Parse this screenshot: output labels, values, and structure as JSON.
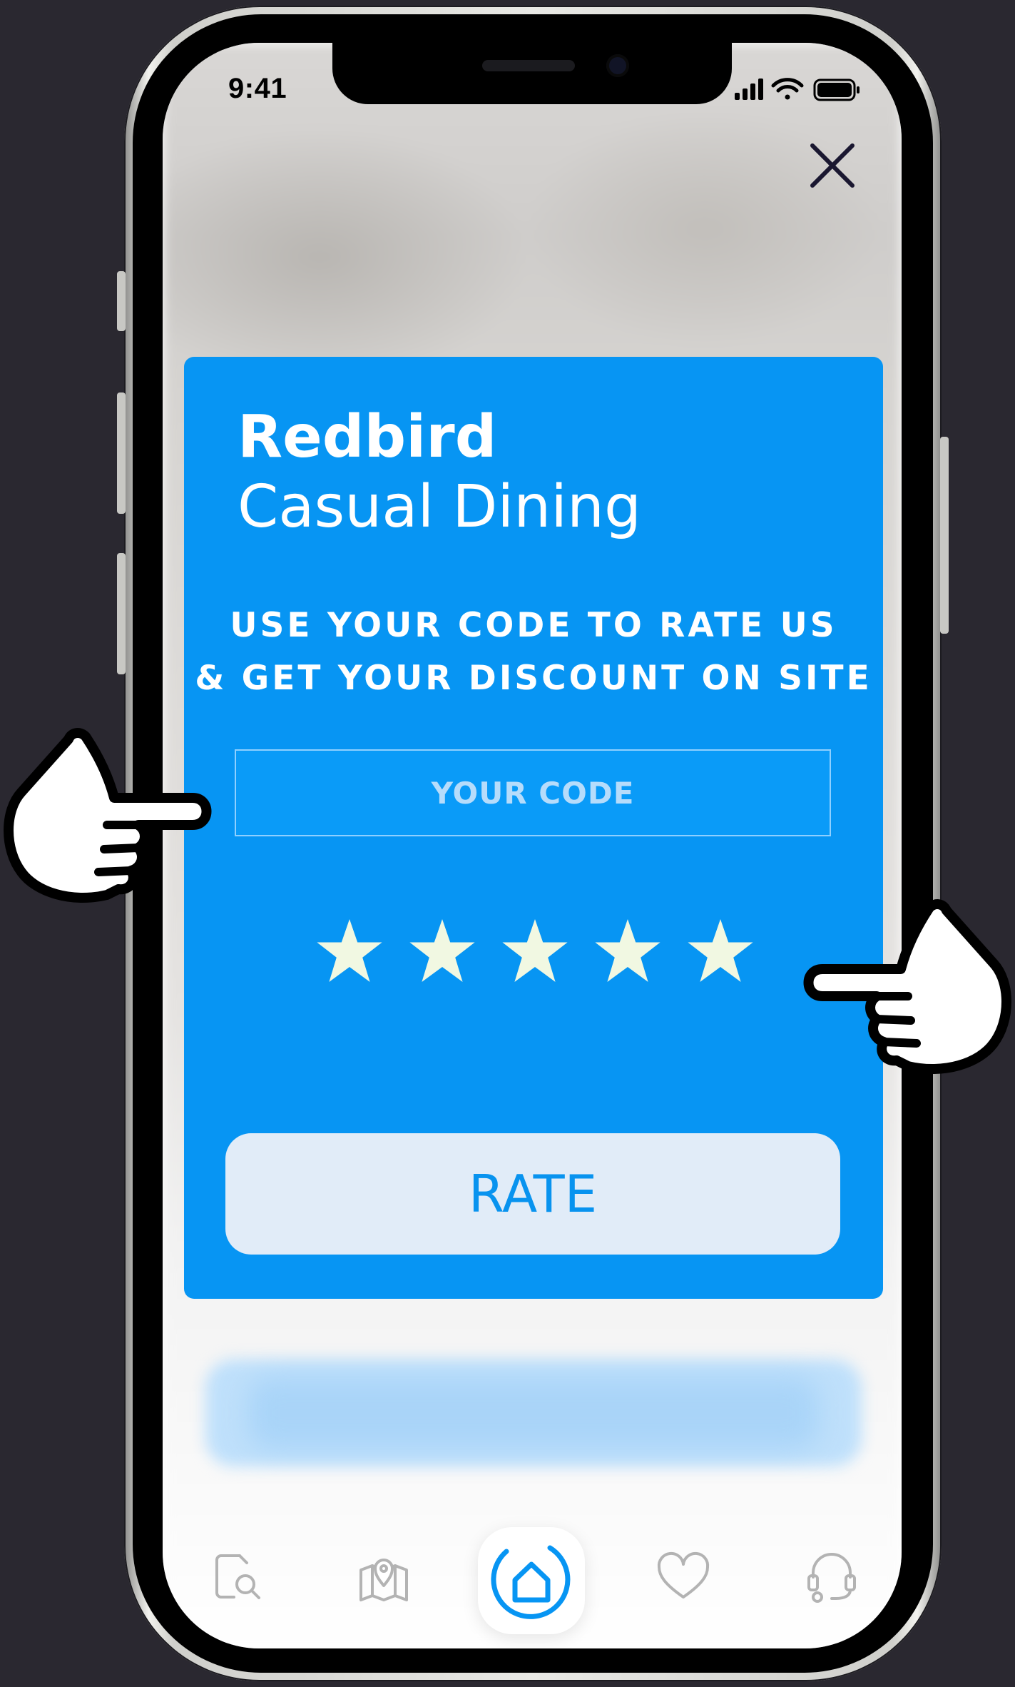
{
  "status_bar": {
    "time": "9:41"
  },
  "modal": {
    "brand_name": "Redbird",
    "brand_subtitle": "Casual Dining",
    "tagline_line1": "USE YOUR CODE TO RATE US",
    "tagline_line2": "& GET YOUR DISCOUNT ON SITE",
    "code_placeholder": "YOUR CODE",
    "code_value": "",
    "rating": {
      "max": 5,
      "selected": 0
    },
    "rate_button_label": "RATE"
  },
  "colors": {
    "modal_background": "#0795f3",
    "star_fill": "#f1f8e2",
    "rate_button_background": "#e1ecf8",
    "rate_button_text": "#0893ef",
    "tab_icon_inactive": "#b3b3b3",
    "tab_icon_active": "#0795f3"
  },
  "tabbar": {
    "items": [
      {
        "icon": "search-document-icon",
        "active": false
      },
      {
        "icon": "map-pin-icon",
        "active": false
      },
      {
        "icon": "home-icon",
        "active": true
      },
      {
        "icon": "heart-icon",
        "active": false
      },
      {
        "icon": "support-headset-icon",
        "active": false
      }
    ]
  },
  "annotations": [
    "pointing-hand-left",
    "pointing-hand-right"
  ]
}
